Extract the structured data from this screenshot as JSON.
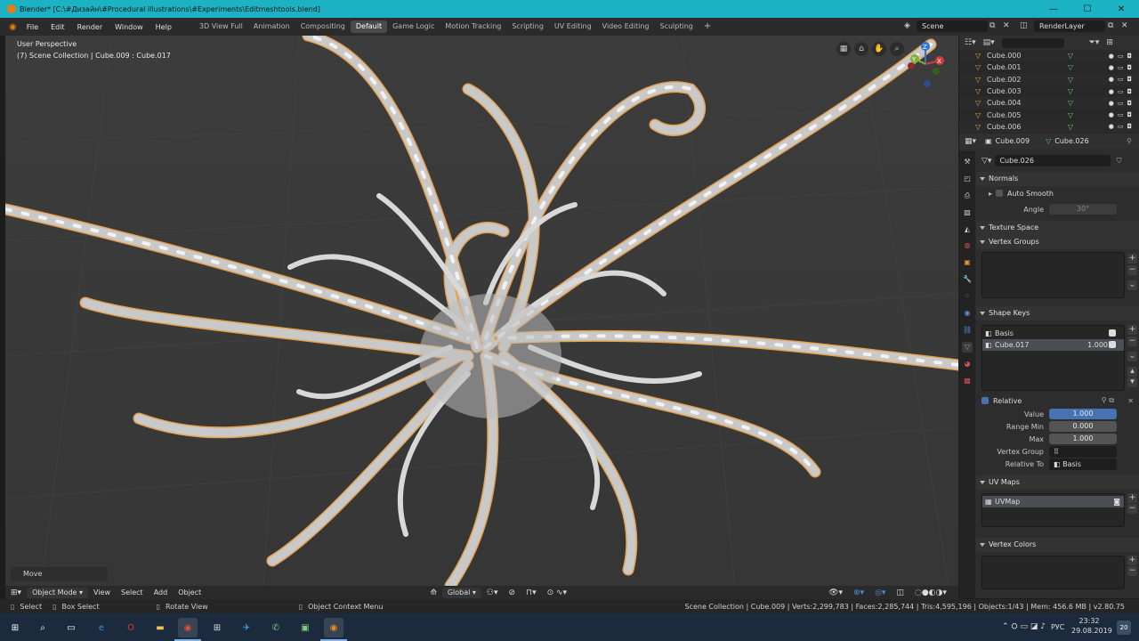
{
  "window": {
    "title": "Blender* [C:\\#Дизайн\\#Procedural illustrations\\#Experiments\\Editmeshtools.blend]",
    "minimize": "—",
    "maximize": "☐",
    "close": "✕"
  },
  "menu": [
    "File",
    "Edit",
    "Render",
    "Window",
    "Help"
  ],
  "workspaces": [
    "3D View Full",
    "Animation",
    "Compositing",
    "Default",
    "Game Logic",
    "Motion Tracking",
    "Scripting",
    "UV Editing",
    "Video Editing",
    "Sculpting"
  ],
  "active_workspace": "Default",
  "scene": {
    "name": "Scene",
    "render_layer": "RenderLayer"
  },
  "viewport": {
    "perspective": "User Perspective",
    "collection_info": "(7) Scene Collection | Cube.009 : Cube.017",
    "last_op": "Move",
    "gizmo": {
      "z": "Z",
      "y": "Y",
      "x": "X"
    }
  },
  "viewport_header": {
    "mode": "Object Mode",
    "menus": [
      "View",
      "Select",
      "Add",
      "Object"
    ],
    "orientation": "Global"
  },
  "outliner": {
    "search_placeholder": "",
    "items": [
      {
        "name": "Cube.000"
      },
      {
        "name": "Cube.001"
      },
      {
        "name": "Cube.002"
      },
      {
        "name": "Cube.003"
      },
      {
        "name": "Cube.004"
      },
      {
        "name": "Cube.005"
      },
      {
        "name": "Cube.006"
      }
    ]
  },
  "properties": {
    "object": "Cube.009",
    "mesh": "Cube.026",
    "datablock": "Cube.026",
    "normals": {
      "title": "Normals",
      "auto_smooth": "Auto Smooth",
      "angle_label": "Angle",
      "angle_value": "30°"
    },
    "texture_space": "Texture Space",
    "vertex_groups": "Vertex Groups",
    "shape_keys": {
      "title": "Shape Keys",
      "keys": [
        {
          "name": "Basis",
          "value": ""
        },
        {
          "name": "Cube.017",
          "value": "1.000"
        }
      ],
      "relative": "Relative",
      "value_label": "Value",
      "value": "1.000",
      "range_min_label": "Range Min",
      "range_min": "0.000",
      "max_label": "Max",
      "max": "1.000",
      "vertex_group_label": "Vertex Group",
      "relative_to_label": "Relative To",
      "relative_to": "Basis"
    },
    "uv_maps": {
      "title": "UV Maps",
      "items": [
        "UVMap"
      ]
    },
    "vertex_colors": "Vertex Colors"
  },
  "statusbar": {
    "select": "Select",
    "box_select": "Box Select",
    "rotate_view": "Rotate View",
    "context_menu": "Object Context Menu",
    "stats": "Scene Collection | Cube.009 | Verts:2,299,783 | Faces:2,285,744 | Tris:4,595,196 | Objects:1/43 | Mem: 456.6 MB | v2.80.75"
  },
  "taskbar": {
    "lang": "РУС",
    "time": "23:32",
    "date": "29.08.2019",
    "notifications": "20"
  },
  "colors": {
    "titlebar": "#1bb3c4",
    "accent_blue": "#4772b3",
    "selection_orange": "#e8a14c",
    "viewport_bg": "#3a3a3a"
  }
}
